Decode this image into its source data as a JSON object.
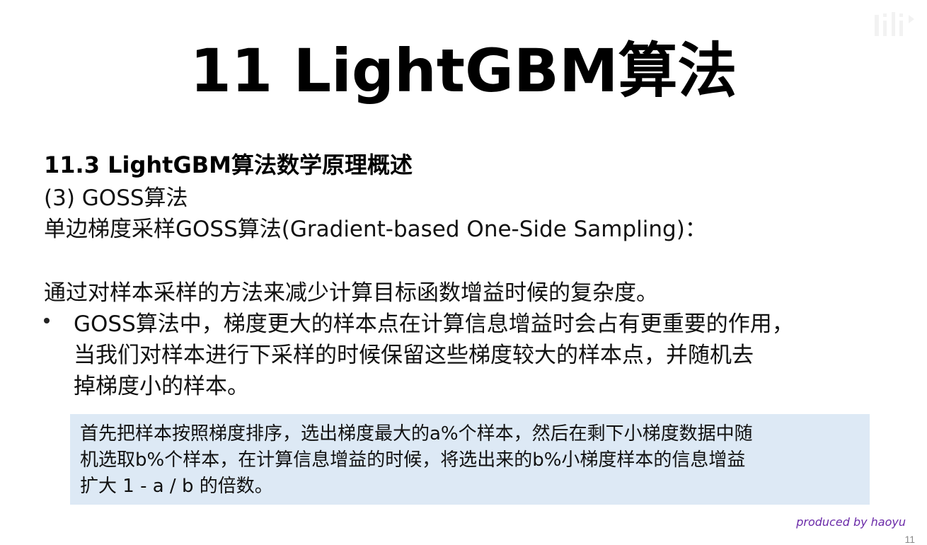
{
  "slide": {
    "title": "11 LightGBM算法",
    "section_heading": "11.3 LightGBM算法数学原理概述",
    "subheading": "(3) GOSS算法",
    "definition": "单边梯度采样GOSS算法(Gradient-based One-Side Sampling)：",
    "intro": "通过对样本采样的方法来减少计算目标函数增益时候的复杂度。",
    "bullets": [
      {
        "lines": [
          "GOSS算法中，梯度更大的样本点在计算信息增益时会占有更重要的作用，",
          "当我们对样本进行下采样的时候保留这些梯度较大的样本点，并随机去",
          "掉梯度小的样本。"
        ]
      }
    ],
    "note": {
      "lines": [
        "首先把样本按照梯度排序，选出梯度最大的a%个样本，然后在剩下小梯度数据中随",
        "机选取b%个样本，在计算信息增益的时候，将选出来的b%小梯度样本的信息增益",
        "扩大 1 - a / b 的倍数。"
      ],
      "background_color": "#dde9f5"
    },
    "credit": "produced by haoyu",
    "page_number": "11"
  },
  "colors": {
    "credit": "#6a2aa8",
    "note_background": "#dde9f5",
    "title": "#000000"
  },
  "icons": {
    "watermark": "bilibili-logo-icon",
    "bullet": "bullet-dot-icon"
  }
}
